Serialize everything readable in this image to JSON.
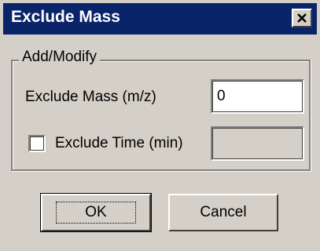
{
  "window": {
    "title": "Exclude Mass",
    "close_icon": "close-x-icon"
  },
  "group": {
    "legend": "Add/Modify",
    "exclude_mass_label": "Exclude Mass (m/z)",
    "exclude_mass_value": "0",
    "exclude_time_label": "Exclude Time (min)",
    "exclude_time_checked": false,
    "exclude_time_value": ""
  },
  "buttons": {
    "ok_label": "OK",
    "cancel_label": "Cancel"
  }
}
